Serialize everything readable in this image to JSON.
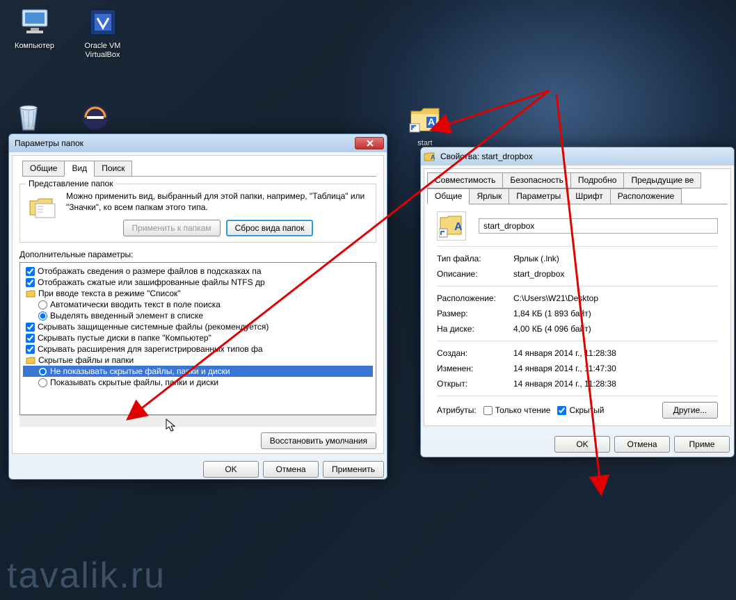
{
  "desktop_icons": {
    "computer": "Компьютер",
    "virtualbox": "Oracle VM VirtualBox",
    "start_folder": "start"
  },
  "watermark": "tavalik.ru",
  "folder_options": {
    "title": "Параметры папок",
    "tabs": {
      "general": "Общие",
      "view": "Вид",
      "search": "Поиск"
    },
    "rep_title": "Представление папок",
    "rep_text": "Можно применить вид, выбранный для этой папки, например, \"Таблица\" или \"Значки\", ко всем папкам этого типа.",
    "apply_to_folders": "Применить к папкам",
    "reset_folders": "Сброс вида папок",
    "adv_label": "Дополнительные параметры:",
    "items": {
      "i0": "Отображать сведения о размере файлов в подсказках па",
      "i1": "Отображать сжатые или зашифрованные файлы NTFS др",
      "i2": "При вводе текста в режиме \"Список\"",
      "i3": "Автоматически вводить текст в поле поиска",
      "i4": "Выделять введенный элемент в списке",
      "i5": "Скрывать защищенные системные файлы (рекомендуется)",
      "i6": "Скрывать пустые диски в папке \"Компьютер\"",
      "i7": "Скрывать расширения для зарегистрированных типов фа",
      "i8": "Скрытые файлы и папки",
      "i9": "Не показывать скрытые файлы, папки и диски",
      "i10": "Показывать скрытые файлы, папки и диски"
    },
    "restore_defaults": "Восстановить умолчания",
    "ok": "OK",
    "cancel": "Отмена",
    "apply": "Применить"
  },
  "props": {
    "title": "Свойства: start_dropbox",
    "tabs_row1": {
      "compat": "Совместимость",
      "security": "Безопасность",
      "details": "Подробно",
      "prev": "Предыдущие ве"
    },
    "tabs_row2": {
      "general": "Общие",
      "shortcut": "Ярлык",
      "params": "Параметры",
      "font": "Шрифт",
      "layout": "Расположение"
    },
    "name": "start_dropbox",
    "rows": {
      "type_l": "Тип файла:",
      "type_v": "Ярлык (.lnk)",
      "desc_l": "Описание:",
      "desc_v": "start_dropbox",
      "loc_l": "Расположение:",
      "loc_v": "C:\\Users\\W21\\Desktop",
      "size_l": "Размер:",
      "size_v": "1,84 КБ (1 893 байт)",
      "disk_l": "На диске:",
      "disk_v": "4,00 КБ (4 096 байт)",
      "created_l": "Создан:",
      "created_v": "14 января 2014 г., 11:28:38",
      "modified_l": "Изменен:",
      "modified_v": "14 января 2014 г., 11:47:30",
      "opened_l": "Открыт:",
      "opened_v": "14 января 2014 г., 11:28:38"
    },
    "attr_label": "Атрибуты:",
    "readonly": "Только чтение",
    "hidden": "Скрытый",
    "other": "Другие...",
    "ok": "OK",
    "cancel": "Отмена",
    "apply": "Приме"
  }
}
